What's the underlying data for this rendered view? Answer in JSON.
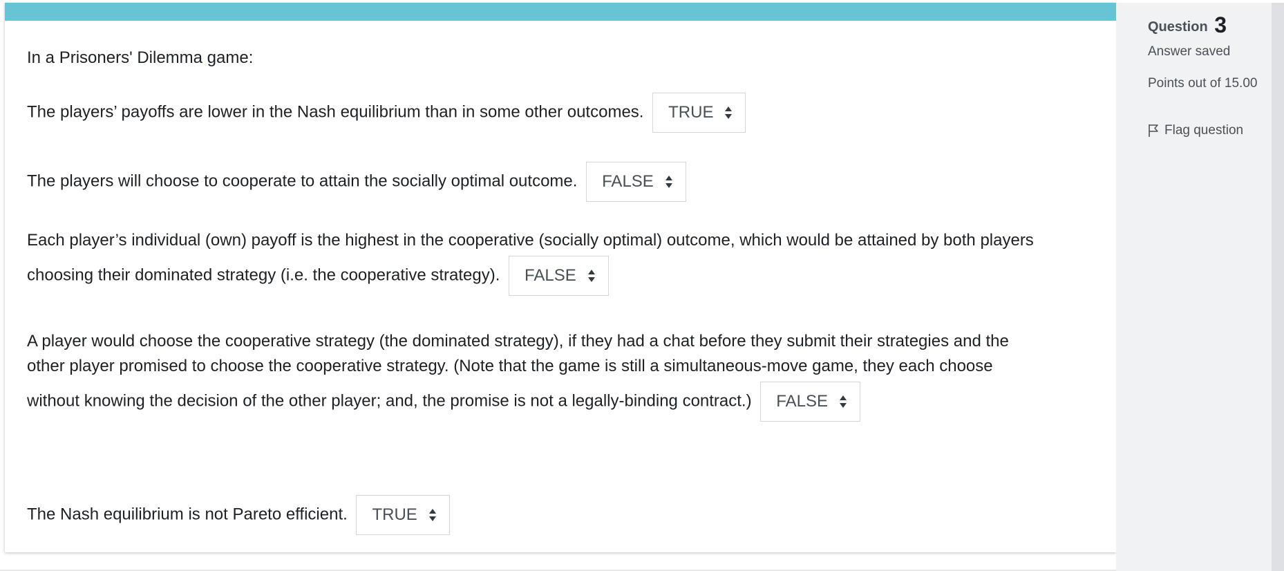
{
  "question": {
    "intro": "In a Prisoners' Dilemma game:",
    "statements": [
      {
        "text_lines": [
          "The players’ payoffs are lower in the Nash equilibrium than in some other outcomes."
        ],
        "answer": "TRUE"
      },
      {
        "text_lines": [
          "The players will choose to cooperate to attain the socially optimal outcome."
        ],
        "answer": "FALSE"
      },
      {
        "text_lines": [
          "Each player’s individual (own) payoff is the highest in the cooperative (socially optimal) outcome, which would be attained by both players",
          "choosing their dominated strategy (i.e. the cooperative strategy)."
        ],
        "answer": "FALSE"
      },
      {
        "text_lines": [
          "A player would choose the cooperative strategy (the dominated strategy), if they had a chat before they submit their strategies and the",
          "other player promised to choose the cooperative strategy. (Note that the game is still a simultaneous-move game, they each choose",
          "without knowing the decision of the other player; and, the promise is not a legally-binding contract.)"
        ],
        "answer": "FALSE"
      },
      {
        "text_lines": [
          "The Nash equilibrium is not Pareto efficient."
        ],
        "answer": "TRUE"
      }
    ]
  },
  "sidebar": {
    "question_label": "Question",
    "question_number": "3",
    "status": "Answer saved",
    "points": "Points out of 15.00",
    "flag_label": "Flag question"
  },
  "colors": {
    "top_bar": "#68c4d4",
    "sidebar_bg": "#f1f2f3",
    "text": "#1d2125",
    "select_text": "#495057"
  },
  "icons": {
    "select_arrows": "chevron-up-down-icon",
    "flag": "flag-icon"
  }
}
